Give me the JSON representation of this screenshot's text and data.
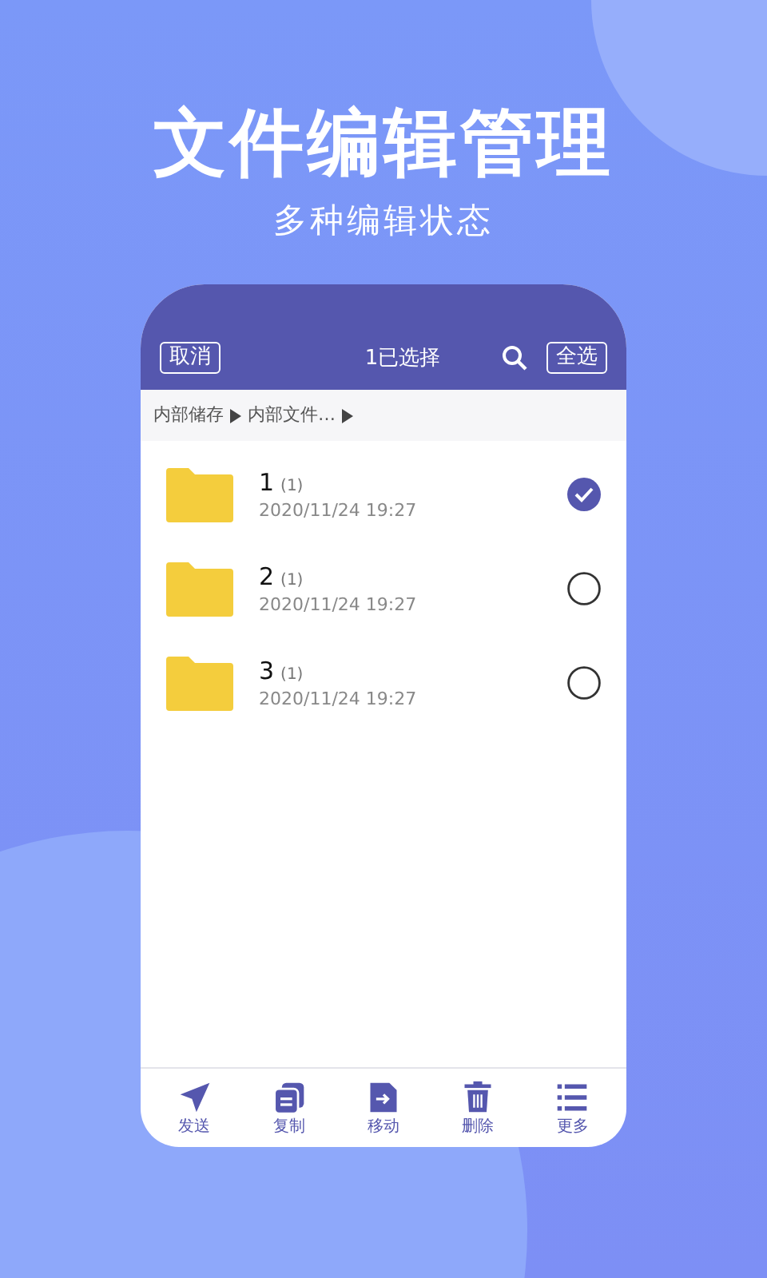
{
  "headline": "文件编辑管理",
  "subheadline": "多种编辑状态",
  "header": {
    "cancel": "取消",
    "title": "1已选择",
    "select_all": "全选"
  },
  "breadcrumb": [
    "内部储存",
    "内部文件…"
  ],
  "files": [
    {
      "name": "1",
      "count": "(1)",
      "date": "2020/11/24 19:27",
      "selected": true
    },
    {
      "name": "2",
      "count": "(1)",
      "date": "2020/11/24 19:27",
      "selected": false
    },
    {
      "name": "3",
      "count": "(1)",
      "date": "2020/11/24 19:27",
      "selected": false
    }
  ],
  "toolbar": [
    {
      "kind": "send",
      "label": "发送"
    },
    {
      "kind": "copy",
      "label": "复制"
    },
    {
      "kind": "move",
      "label": "移动"
    },
    {
      "kind": "delete",
      "label": "删除"
    },
    {
      "kind": "more",
      "label": "更多"
    }
  ]
}
